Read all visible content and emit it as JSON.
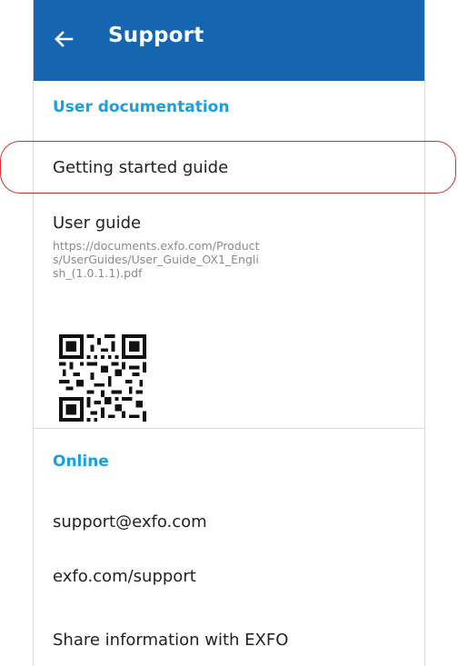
{
  "header": {
    "title": "Support",
    "back_icon": "arrow-left-icon",
    "color": "#1565b0"
  },
  "sections": {
    "user_docs": {
      "title": "User documentation"
    },
    "online": {
      "title": "Online"
    }
  },
  "items": {
    "getting_started": "Getting started guide",
    "user_guide": {
      "label": "User guide",
      "url": "https://documents.exfo.com/Products/UserGuides/User_Guide_OX1_English_(1.0.1.1).pdf"
    },
    "email": "support@exfo.com",
    "website": "exfo.com/support",
    "share": "Share information with EXFO"
  },
  "colors": {
    "accent": "#1a9fe0",
    "highlight": "#d32f2f"
  }
}
